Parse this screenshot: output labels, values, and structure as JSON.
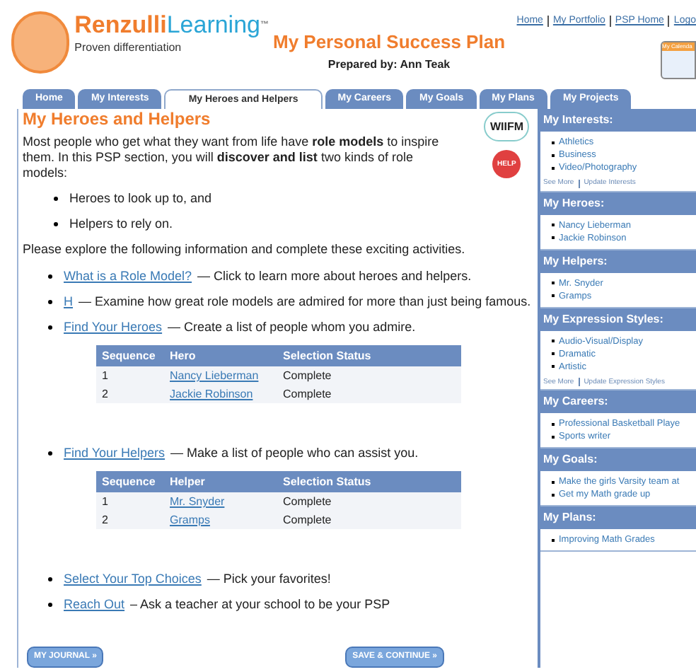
{
  "logo": {
    "brand_a": "Renzulli",
    "brand_b": "Learning",
    "tagline": "Proven differentiation",
    "tm": "™"
  },
  "header": {
    "title": "My Personal Success Plan",
    "subtitle": "Prepared by: Ann Teak"
  },
  "top_links": [
    "Home",
    "My Portfolio",
    "PSP Home",
    "Logo"
  ],
  "calendar": {
    "label": "My Calenda"
  },
  "tabs": [
    {
      "label": "Home",
      "selected": false
    },
    {
      "label": "My Interests",
      "selected": false
    },
    {
      "label": "My Heroes and Helpers",
      "selected": true
    },
    {
      "label": "My Careers",
      "selected": false
    },
    {
      "label": "My Goals",
      "selected": false
    },
    {
      "label": "My Plans",
      "selected": false
    },
    {
      "label": "My Projects",
      "selected": false
    }
  ],
  "main": {
    "heading": "My Heroes and Helpers",
    "intro": "Most people who get what they want from life have **role models** to inspire them. In this PSP section, you will **discover and list** two kinds of role models:",
    "kinds": [
      "Heroes to look up to, and",
      "Helpers to rely on."
    ],
    "prompt": "Please explore the following information and complete these exciting activities.",
    "activities": [
      {
        "link": "What is a Role Model?",
        "text": "— Click to learn more about heroes and helpers."
      },
      {
        "link": "H",
        "text": "— Examine how great role models are admired for more than just being famous."
      },
      {
        "link": "Find Your Heroes",
        "text": "— Create a list of people whom you admire.",
        "table": {
          "columns": [
            "Sequence",
            "Hero",
            "Selection Status"
          ],
          "rows": [
            [
              "1",
              "Nancy Lieberman",
              "Complete"
            ],
            [
              "2",
              "Jackie Robinson",
              "Complete"
            ]
          ]
        }
      },
      {
        "link": "Find Your Helpers",
        "text": "— Make a list of people who can assist you.",
        "table": {
          "columns": [
            "Sequence",
            "Helper",
            "Selection Status"
          ],
          "rows": [
            [
              "1",
              "Mr. Snyder",
              "Complete"
            ],
            [
              "2",
              "Gramps",
              "Complete"
            ]
          ]
        }
      },
      {
        "link": "Select Your Top Choices",
        "text": "— Pick your favorites!"
      },
      {
        "link": "Reach Out",
        "text": "– Ask a teacher at your school to be your PSP"
      }
    ],
    "wiifm": "WIIFM",
    "help": "HELP",
    "buttons": [
      "MY JOURNAL »",
      "SAVE & CONTINUE »"
    ]
  },
  "sidebar": [
    {
      "title": "My Interests:",
      "items": [
        "Athletics",
        "Business",
        "Video/Photography"
      ],
      "links": [
        "See More",
        "Update Interests"
      ]
    },
    {
      "title": "My Heroes:",
      "items": [
        "Nancy Lieberman",
        "Jackie Robinson"
      ]
    },
    {
      "title": "My Helpers:",
      "items": [
        "Mr. Snyder",
        "Gramps"
      ]
    },
    {
      "title": "My Expression Styles:",
      "items": [
        "Audio-Visual/Display",
        "Dramatic",
        "Artistic"
      ],
      "links": [
        "See More",
        "Update Expression Styles"
      ]
    },
    {
      "title": "My Careers:",
      "items": [
        "Professional Basketball Playe",
        "Sports writer"
      ]
    },
    {
      "title": "My Goals:",
      "items": [
        "Make the girls Varsity team at",
        "Get my Math grade up"
      ]
    },
    {
      "title": "My Plans:",
      "items": [
        "Improving Math Grades"
      ]
    }
  ]
}
